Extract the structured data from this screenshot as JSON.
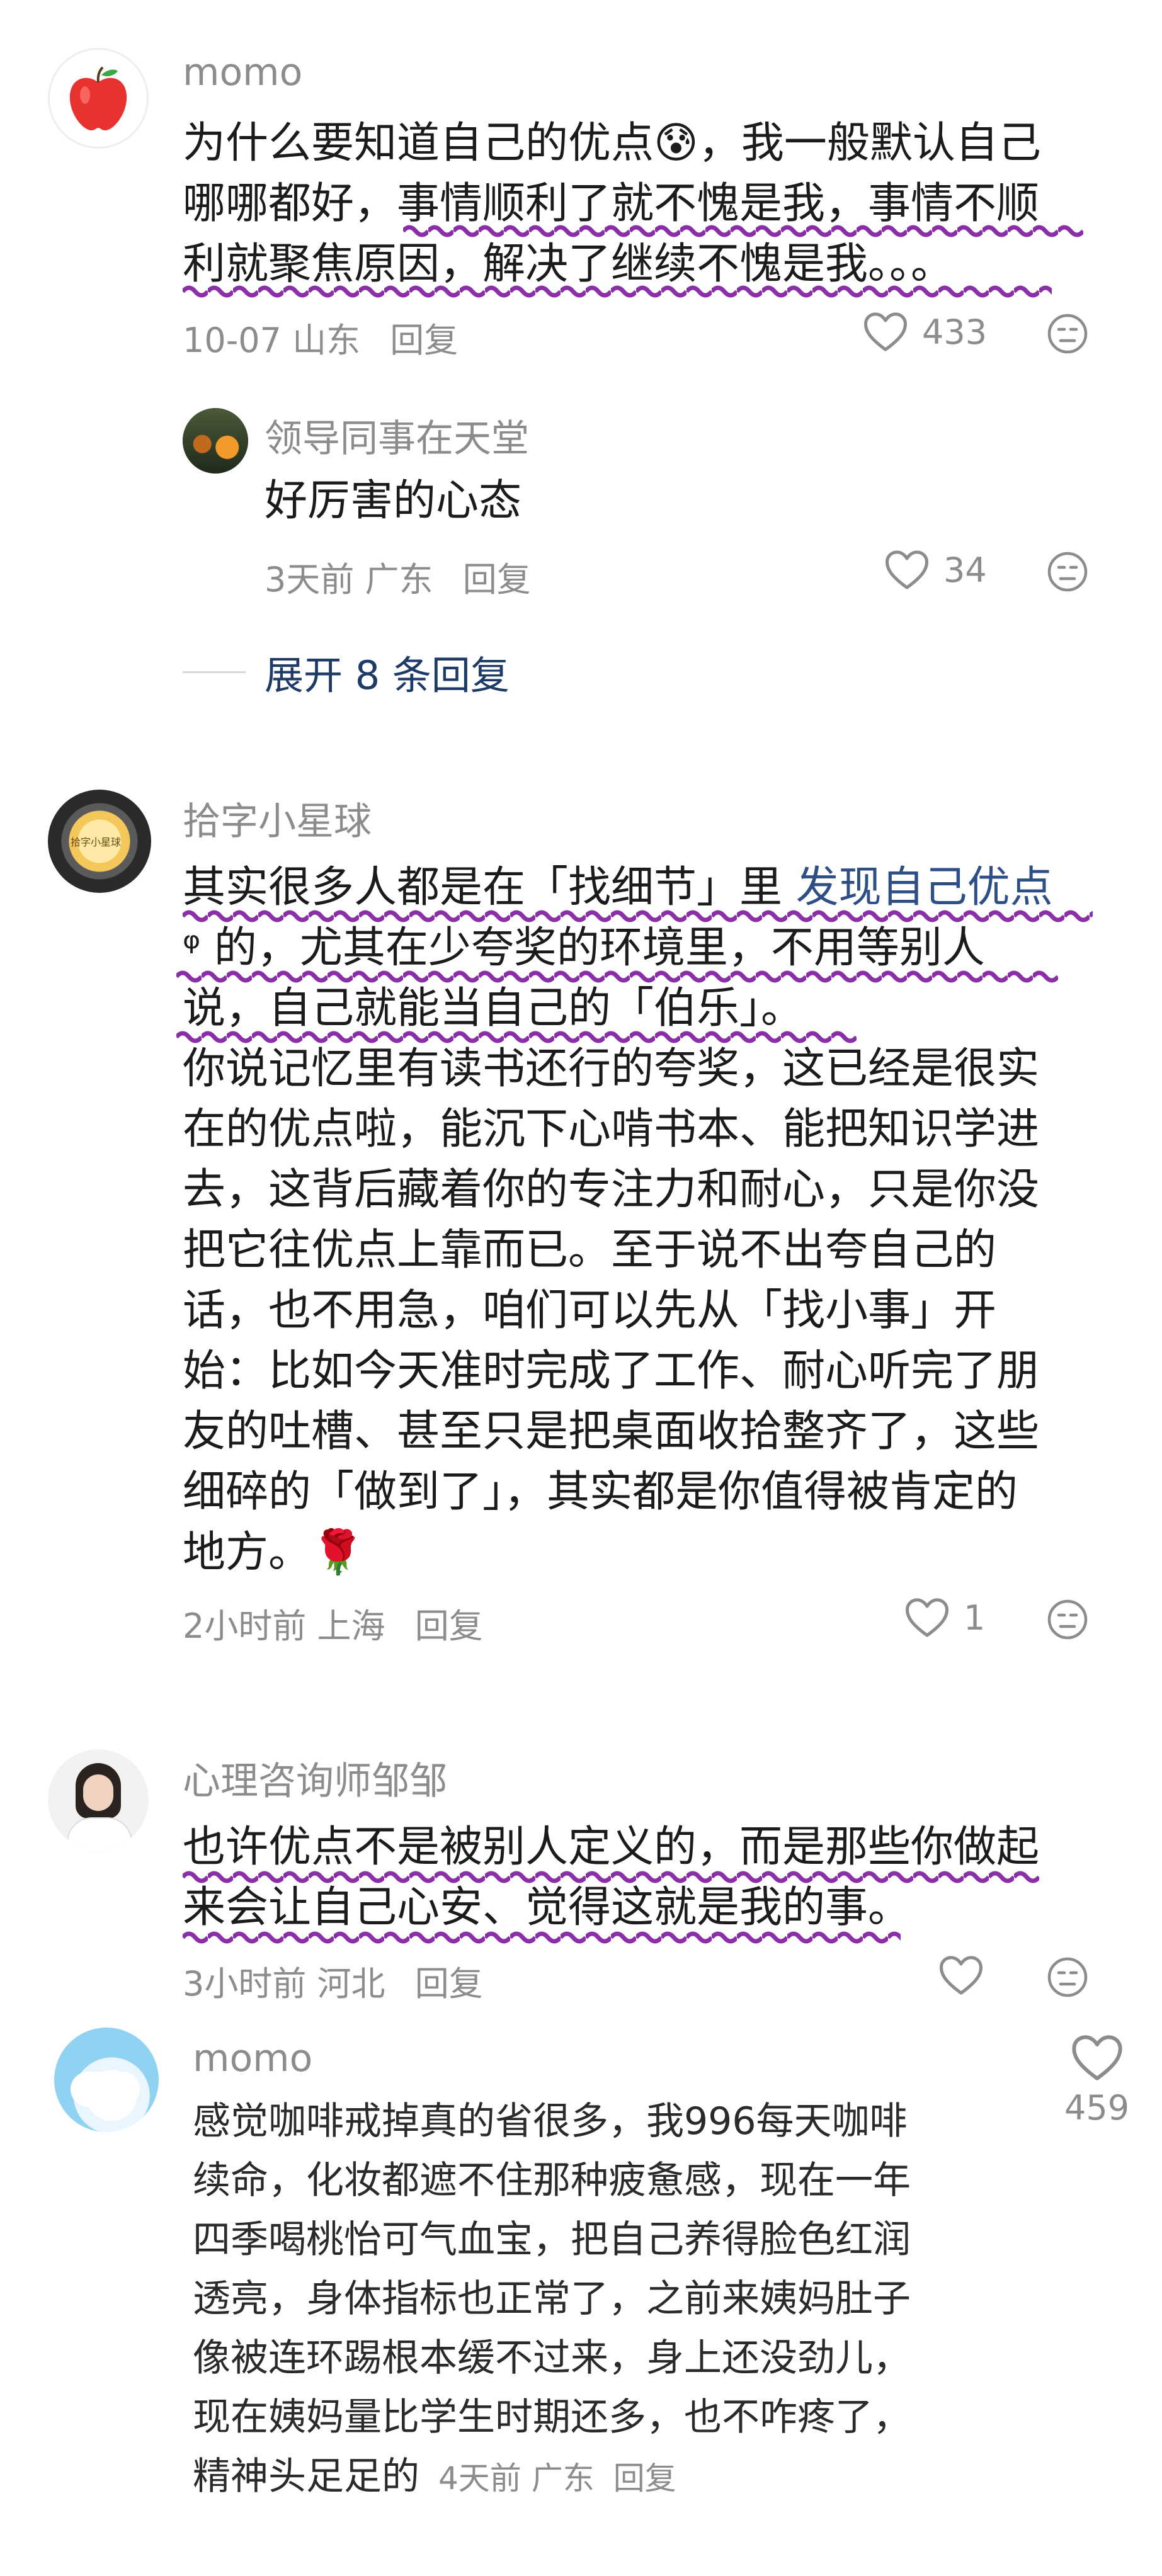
{
  "comments": [
    {
      "username": "momo",
      "avatar_icon": "apple-icon",
      "lines": [
        "为什么要知道自己的优点😰，我一般默认自己",
        "哪哪都好，事情顺利了就不愧是我，事情不顺",
        "利就聚焦原因，解决了继续不愧是我。。。"
      ],
      "date": "10-07",
      "location": "山东",
      "reply_label": "回复",
      "likes": "433"
    },
    {
      "username": "领导同事在天堂",
      "lines": [
        "好厉害的心态"
      ],
      "date": "3天前",
      "location": "广东",
      "reply_label": "回复",
      "likes": "34"
    },
    {
      "username": "拾字小星球",
      "lines_a": [
        "其实很多人都是在「找细节」里 ",
        "ᵠ 的，尤其在少夸奖的环境里，不用等别人",
        "说，自己就能当自己的「伯乐」。",
        "你说记忆里有读书还行的夸奖，这已经是很实",
        "在的优点啦，能沉下心啃书本、能把知识学进",
        "去，这背后藏着你的专注力和耐心，只是你没",
        "把它往优点上靠而已。至于说不出夸自己的",
        "话，也不用急，咱们可以先从「找小事」开",
        "始：比如今天准时完成了工作、耐心听完了朋",
        "友的吐槽、甚至只是把桌面收拾整齐了，这些",
        "细碎的「做到了」，其实都是你值得被肯定的",
        "地方。🌹"
      ],
      "link_text": "发现自己优点",
      "date": "2小时前",
      "location": "上海",
      "reply_label": "回复",
      "likes": "1"
    },
    {
      "username": "心理咨询师邹邹",
      "lines": [
        "也许优点不是被别人定义的，而是那些你做起",
        "来会让自己心安、觉得这就是我的事。"
      ],
      "date": "3小时前",
      "location": "河北",
      "reply_label": "回复"
    },
    {
      "username": "momo",
      "lines": [
        "感觉咖啡戒掉真的省很多，我996每天咖啡",
        "续命，化妆都遮不住那种疲惫感，现在一年",
        "四季喝桃怡可气血宝，把自己养得脸色红润",
        "透亮，身体指标也正常了，之前来姨妈肚子",
        "像被连环踢根本缓不过来，身上还没劲儿，",
        "现在姨妈量比学生时期还多，也不咋疼了，",
        "精神头足足的"
      ],
      "date": "4天前",
      "location": "广东",
      "reply_label": "回复",
      "likes": "459"
    }
  ],
  "expand_replies": "展开 8 条回复",
  "colors": {
    "wave_underline": "#8a2fa8",
    "link": "#2d4f86",
    "meta_text": "#8c8c8c"
  }
}
